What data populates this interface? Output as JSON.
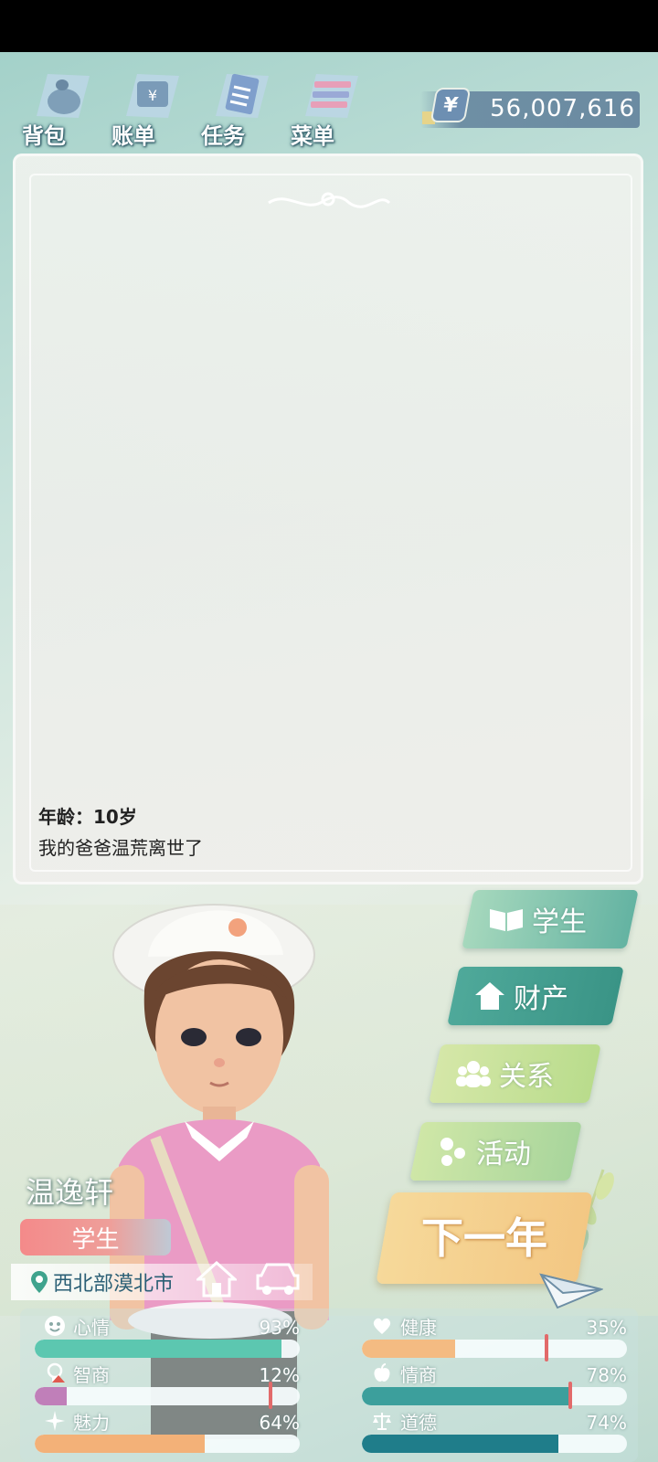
{
  "nav": {
    "bag": "背包",
    "bill": "账单",
    "task": "任务",
    "menu": "菜单"
  },
  "money": {
    "symbol": "¥",
    "value": "56,007,616"
  },
  "event": {
    "age_line": "年龄：10岁",
    "text": "我的爸爸温荒离世了"
  },
  "side_buttons": {
    "student": "学生",
    "assets": "财产",
    "relations": "关系",
    "activities": "活动"
  },
  "next_year": "下一年",
  "character": {
    "name": "温逸轩",
    "role": "学生",
    "location": "西北部漠北市"
  },
  "stats": {
    "mood": {
      "label": "心情",
      "value": "93%",
      "level": 0.93,
      "color": "#5cc7b0"
    },
    "health": {
      "label": "健康",
      "value": "35%",
      "level": 0.35,
      "color": "#f4bb82"
    },
    "iq": {
      "label": "智商",
      "value": "12%",
      "level": 0.12,
      "color": "#c07fb9"
    },
    "eq": {
      "label": "情商",
      "value": "78%",
      "level": 0.78,
      "color": "#3c9f9c"
    },
    "charm": {
      "label": "魅力",
      "value": "64%",
      "level": 0.64,
      "color": "#f3b178"
    },
    "morality": {
      "label": "道德",
      "value": "74%",
      "level": 0.74,
      "color": "#1f7d8a"
    }
  }
}
